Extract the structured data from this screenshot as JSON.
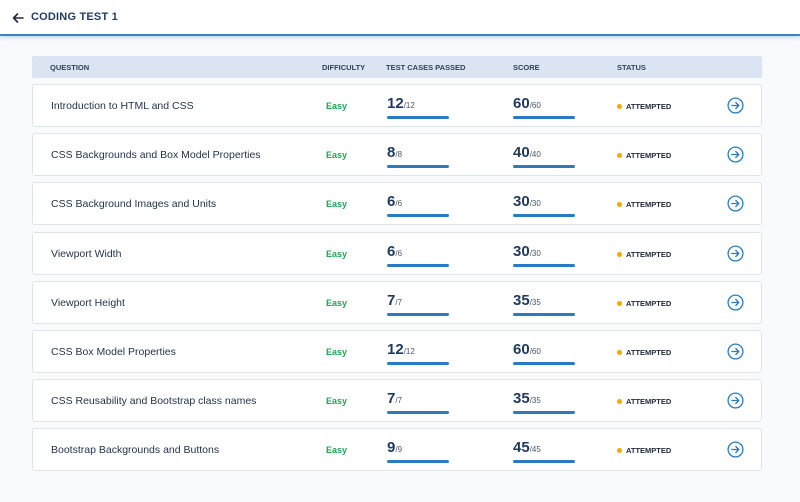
{
  "header": {
    "title": "CODING TEST 1"
  },
  "columns": {
    "question": "QUESTION",
    "difficulty": "DIFFICULTY",
    "test_cases": "TEST CASES PASSED",
    "score": "SCORE",
    "status": "STATUS"
  },
  "colors": {
    "accent": "#2b7bc4",
    "easy": "#22a455",
    "status_dot": "#f2a900",
    "title": "#1e3a5f"
  },
  "icons": {
    "back": "arrow-left-icon",
    "open": "arrow-right-circle-icon"
  },
  "rows": [
    {
      "question": "Introduction to HTML and CSS",
      "difficulty": "Easy",
      "passed": "12",
      "total_cases": "/12",
      "score": "60",
      "max_score": "/60",
      "progress": 1.0,
      "status": "ATTEMPTED"
    },
    {
      "question": "CSS Backgrounds and Box Model Properties",
      "difficulty": "Easy",
      "passed": "8",
      "total_cases": "/8",
      "score": "40",
      "max_score": "/40",
      "progress": 1.0,
      "status": "ATTEMPTED"
    },
    {
      "question": "CSS Background Images and Units",
      "difficulty": "Easy",
      "passed": "6",
      "total_cases": "/6",
      "score": "30",
      "max_score": "/30",
      "progress": 1.0,
      "status": "ATTEMPTED"
    },
    {
      "question": "Viewport Width",
      "difficulty": "Easy",
      "passed": "6",
      "total_cases": "/6",
      "score": "30",
      "max_score": "/30",
      "progress": 1.0,
      "status": "ATTEMPTED"
    },
    {
      "question": "Viewport Height",
      "difficulty": "Easy",
      "passed": "7",
      "total_cases": "/7",
      "score": "35",
      "max_score": "/35",
      "progress": 1.0,
      "status": "ATTEMPTED"
    },
    {
      "question": "CSS Box Model Properties",
      "difficulty": "Easy",
      "passed": "12",
      "total_cases": "/12",
      "score": "60",
      "max_score": "/60",
      "progress": 1.0,
      "status": "ATTEMPTED"
    },
    {
      "question": "CSS Reusability and Bootstrap class names",
      "difficulty": "Easy",
      "passed": "7",
      "total_cases": "/7",
      "score": "35",
      "max_score": "/35",
      "progress": 1.0,
      "status": "ATTEMPTED"
    },
    {
      "question": "Bootstrap Backgrounds and Buttons",
      "difficulty": "Easy",
      "passed": "9",
      "total_cases": "/9",
      "score": "45",
      "max_score": "/45",
      "progress": 1.0,
      "status": "ATTEMPTED"
    }
  ]
}
